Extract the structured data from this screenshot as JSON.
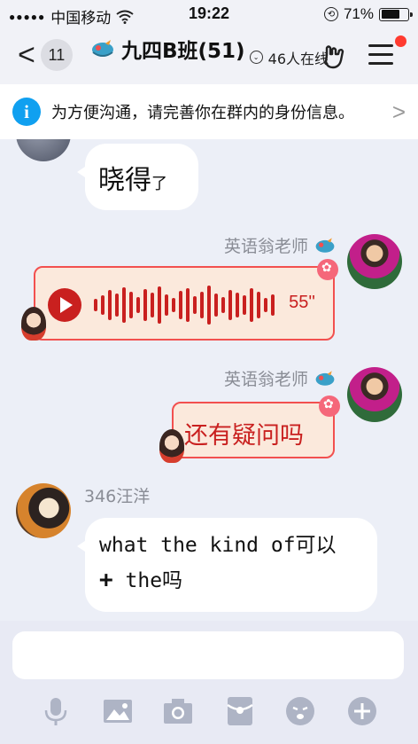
{
  "status_bar": {
    "carrier": "中国移动",
    "time": "19:22",
    "battery": "71%",
    "battery_level": 0.71
  },
  "header": {
    "back_count": "11",
    "title": "九四B班(51)",
    "online": "46人在线"
  },
  "banner": {
    "text": "为方便沟通，请完善你在群内的身份信息。"
  },
  "messages": [
    {
      "type": "text",
      "side": "left",
      "text": "晓得",
      "suffix": "了"
    },
    {
      "type": "voice",
      "side": "right",
      "sender": "英语翁老师",
      "duration": "55''"
    },
    {
      "type": "text",
      "side": "right",
      "sender": "英语翁老师",
      "text": "还有疑问吗"
    },
    {
      "type": "text",
      "side": "left",
      "sender": "346汪洋",
      "line1": "what the kind of可以",
      "line2_plus": "+",
      "line2": "the吗"
    }
  ],
  "input": {
    "placeholder": ""
  },
  "toolbar": [
    "mic-icon",
    "image-icon",
    "camera-icon",
    "red-packet-icon",
    "emoji-icon",
    "plus-icon"
  ]
}
